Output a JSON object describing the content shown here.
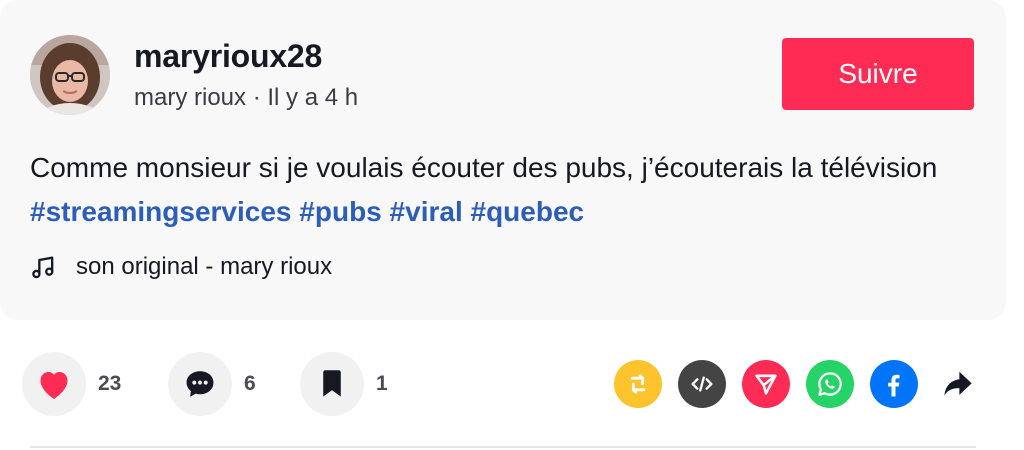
{
  "post": {
    "username": "maryrioux28",
    "display_name": "mary rioux",
    "separator": " · ",
    "time_ago": "Il y a 4 h",
    "follow_label": "Suivre",
    "description": "Comme monsieur si je voulais écouter des pubs, j’écouterais la télévision",
    "hashtags": [
      "#streamingservices",
      "#pubs",
      "#viral",
      "#quebec"
    ],
    "music_label": "son original - mary rioux"
  },
  "actions": {
    "likes": "23",
    "comments": "6",
    "bookmarks": "1"
  },
  "share_icons": [
    "repost-icon",
    "embed-icon",
    "send-to-friends-icon",
    "whatsapp-icon",
    "facebook-icon",
    "share-arrow-icon"
  ],
  "colors": {
    "accent": "#fe2c55",
    "hashtag": "#2b5db9",
    "card_bg": "#f8f8f8",
    "repost": "#fdc32c",
    "embed": "#444444",
    "send": "#fe2c55",
    "whatsapp": "#25d366",
    "facebook": "#0075fa"
  }
}
